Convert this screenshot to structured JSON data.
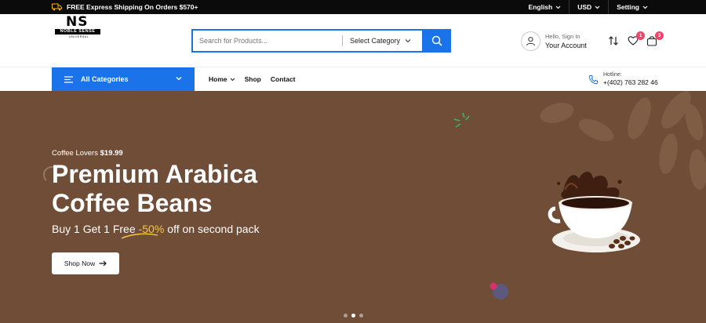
{
  "topbar": {
    "shipping_text": "FREE Express Shipping On Orders $570+",
    "language": "English",
    "currency": "USD",
    "settings": "Setting"
  },
  "header": {
    "logo_mark": "NS",
    "logo_name": "NOBLE SENSE",
    "logo_sub": "UNIVERSAL",
    "search_placeholder": "Search for Products...",
    "category_select": "Select Category",
    "account_line1": "Hello, Sign In",
    "account_line2": "Your Account",
    "wishlist_count": "1",
    "cart_count": "3"
  },
  "nav": {
    "all_categories": "All Categories",
    "menu": [
      "Home",
      "Shop",
      "Contact"
    ],
    "hotline_label": "Hotline:",
    "hotline_number": "+(402) 763 282 46"
  },
  "hero": {
    "pre_text": "Coffee Lovers",
    "pre_price": "$19.99",
    "title_line1": "Premium Arabica",
    "title_line2": "Coffee Beans",
    "promo_a": "Buy 1 Get 1 Free",
    "promo_highlight": "-50%",
    "promo_b": "off on second pack",
    "button": "Shop Now",
    "slides_total": 3,
    "active_slide": 2
  },
  "colors": {
    "accent": "#1a73e8",
    "hero_bg": "#6f4d37",
    "badge": "#f0456a",
    "highlight": "#f7c843"
  }
}
